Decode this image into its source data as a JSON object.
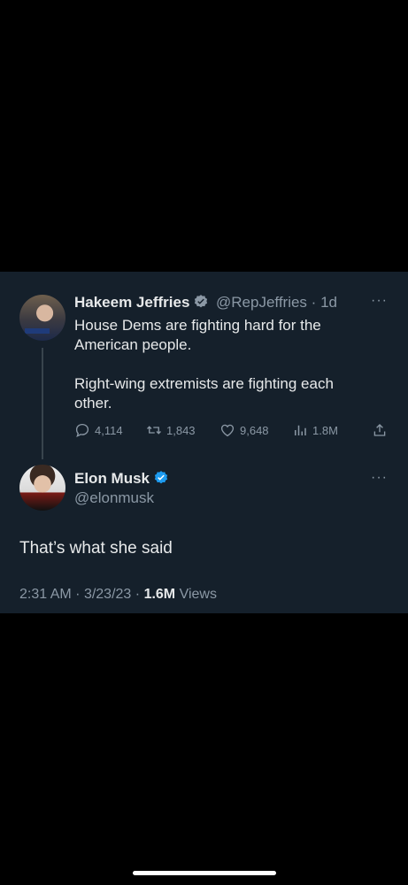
{
  "reply_to": {
    "name": "Hakeem Jeffries",
    "handle": "@RepJeffries",
    "separator": "·",
    "time": "1d",
    "text_line1": "House Dems are fighting hard for the American people.",
    "text_line2": "Right-wing extremists are fighting each other.",
    "stats": {
      "replies": "4,114",
      "retweets": "1,843",
      "likes": "9,648",
      "views": "1.8M"
    },
    "icons": [
      "reply-icon",
      "retweet-icon",
      "like-icon",
      "views-icon",
      "share-icon"
    ]
  },
  "tweet": {
    "name": "Elon Musk",
    "handle": "@elonmusk",
    "text": "That’s what she said",
    "time": "2:31 AM",
    "date": "3/23/23",
    "separator": "·",
    "views_count": "1.6M",
    "views_label": "Views"
  },
  "more_label": "···",
  "colors": {
    "background": "#15202b",
    "verified": "#1d9bf0",
    "muted": "#8b98a5",
    "text": "#e7e9ea"
  }
}
